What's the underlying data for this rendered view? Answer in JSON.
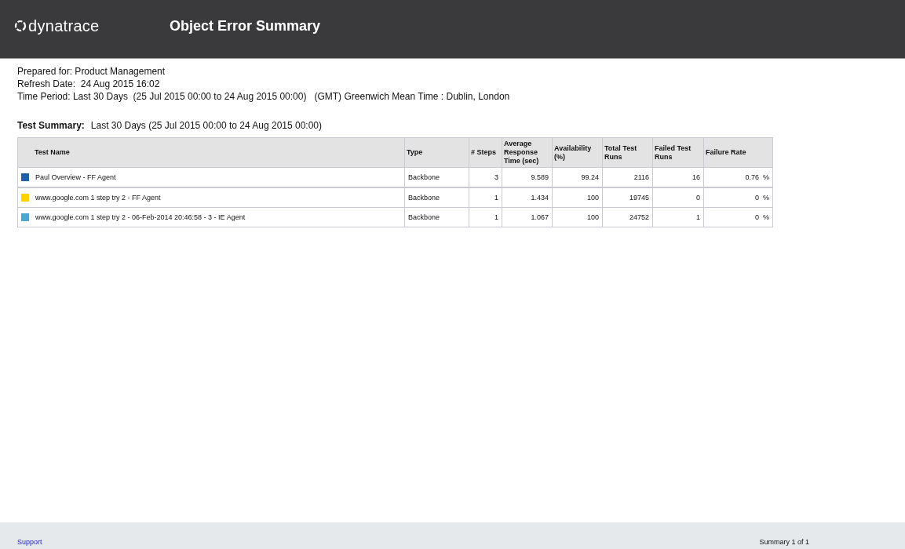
{
  "header": {
    "logo_text": "dynatrace",
    "title": "Object Error Summary"
  },
  "info": [
    "Prepared for: Product Management",
    "Refresh Date:  24 Aug 2015 16:02",
    "Time Period: Last 30 Days  (25 Jul 2015 00:00 to 24 Aug 2015 00:00)   (GMT) Greenwich Mean Time : Dublin, London"
  ],
  "summary": {
    "label": "Test Summary:",
    "period": "Last 30 Days  (25 Jul 2015 00:00 to 24 Aug 2015 00:00)"
  },
  "table": {
    "columns": [
      "Test Name",
      "Type",
      "# Steps",
      "Average Response Time (sec)",
      "Availability (%)",
      "Total Test Runs",
      "Failed Test Runs",
      "Failure Rate"
    ],
    "rows": [
      {
        "color": "#1f5fa8",
        "cells": [
          "Paul Overview - FF Agent",
          "Backbone",
          "3",
          "9.589",
          "99.24",
          "2116",
          "16",
          "0.76  %"
        ]
      },
      {
        "color": "#ffd100",
        "cells": [
          "www.google.com 1 step try 2 - FF Agent",
          "Backbone",
          "1",
          "1.434",
          "100",
          "19745",
          "0",
          "0  %"
        ]
      },
      {
        "color": "#4ea6d0",
        "cells": [
          "www.google.com 1 step try 2 - 06-Feb-2014 20:46:58 - 3 - IE Agent",
          "Backbone",
          "1",
          "1.067",
          "100",
          "24752",
          "1",
          "0  %"
        ]
      }
    ]
  },
  "footer": {
    "link": "Support",
    "page": "Summary 1 of 1"
  }
}
